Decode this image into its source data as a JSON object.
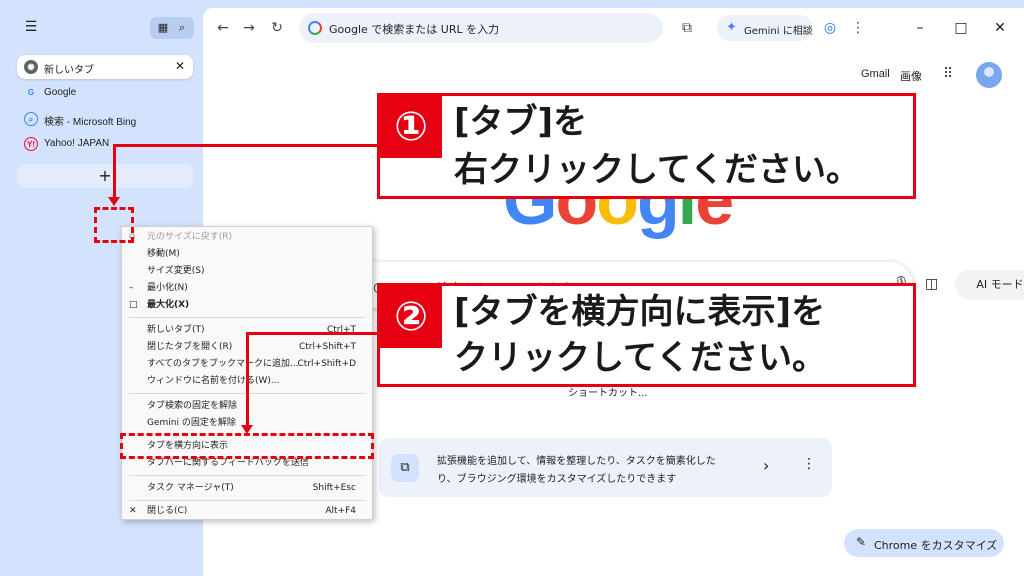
{
  "sidebar": {
    "tabs": [
      {
        "label": "新しいタブ",
        "icon": "chrome-icon",
        "active": true
      },
      {
        "label": "Google",
        "icon": "google-g-icon",
        "active": false
      },
      {
        "label": "検索 - Microsoft Bing",
        "icon": "search-icon",
        "active": false
      },
      {
        "label": "Yahoo! JAPAN",
        "icon": "yahoo-icon",
        "active": false
      }
    ],
    "close_glyph": "✕",
    "new_tab_glyph": "+"
  },
  "toolbar": {
    "omnibox_placeholder": "Google で検索または URL を入力",
    "gemini_label": "Gemini に相談"
  },
  "ntp": {
    "gmail": "Gmail",
    "images": "画像",
    "logo": [
      "G",
      "o",
      "o",
      "g",
      "l",
      "e"
    ],
    "search_placeholder": "Google で検索または URL を入力",
    "ai_mode": "AI モード",
    "shortcut_label": "ショートカット...",
    "ext_card_line1": "拡張機能を追加して、情報を整理したり、タスクを簡素化した",
    "ext_card_line2": "り、ブラウジング環境をカスタマイズしたりできます",
    "customize": "Chrome をカスタマイズ"
  },
  "context_menu": {
    "items": [
      {
        "label": "元のサイズに戻す(R)",
        "shortcut": "",
        "mark": "⧉",
        "disabled": true
      },
      {
        "label": "移動(M)",
        "shortcut": "",
        "mark": ""
      },
      {
        "label": "サイズ変更(S)",
        "shortcut": "",
        "mark": ""
      },
      {
        "label": "最小化(N)",
        "shortcut": "",
        "mark": "–"
      },
      {
        "label": "最大化(X)",
        "shortcut": "",
        "mark": "□",
        "bold": true
      },
      {
        "label": "新しいタブ(T)",
        "shortcut": "Ctrl+T",
        "mark": ""
      },
      {
        "label": "閉じたタブを開く(R)",
        "shortcut": "Ctrl+Shift+T",
        "mark": ""
      },
      {
        "label": "すべてのタブをブックマークに追加...",
        "shortcut": "Ctrl+Shift+D",
        "mark": ""
      },
      {
        "label": "ウィンドウに名前を付ける(W)...",
        "shortcut": "",
        "mark": ""
      },
      {
        "label": "タブ検索の固定を解除",
        "shortcut": "",
        "mark": ""
      },
      {
        "label": "Gemini の固定を解除",
        "shortcut": "",
        "mark": ""
      },
      {
        "label": "タブを横方向に表示",
        "shortcut": "",
        "mark": ""
      },
      {
        "label": "タブバーに関するフィードバックを送信",
        "shortcut": "",
        "mark": ""
      },
      {
        "label": "タスク マネージャ(T)",
        "shortcut": "Shift+Esc",
        "mark": ""
      },
      {
        "label": "閉じる(C)",
        "shortcut": "Alt+F4",
        "mark": "✕"
      }
    ]
  },
  "annotations": {
    "step1_badge": "①",
    "step1_line1": "[タブ]を",
    "step1_line2": "右クリックしてください。",
    "step2_badge": "②",
    "step2_line1": "[タブを横方向に表示]を",
    "step2_line2": "クリックしてください。"
  },
  "colors": {
    "accent_red": "#e60012",
    "sidebar_bg": "#d3e3fd",
    "google_blue": "#4285f4",
    "google_red": "#ea4335",
    "google_yellow": "#fbbc05",
    "google_green": "#34a853"
  }
}
